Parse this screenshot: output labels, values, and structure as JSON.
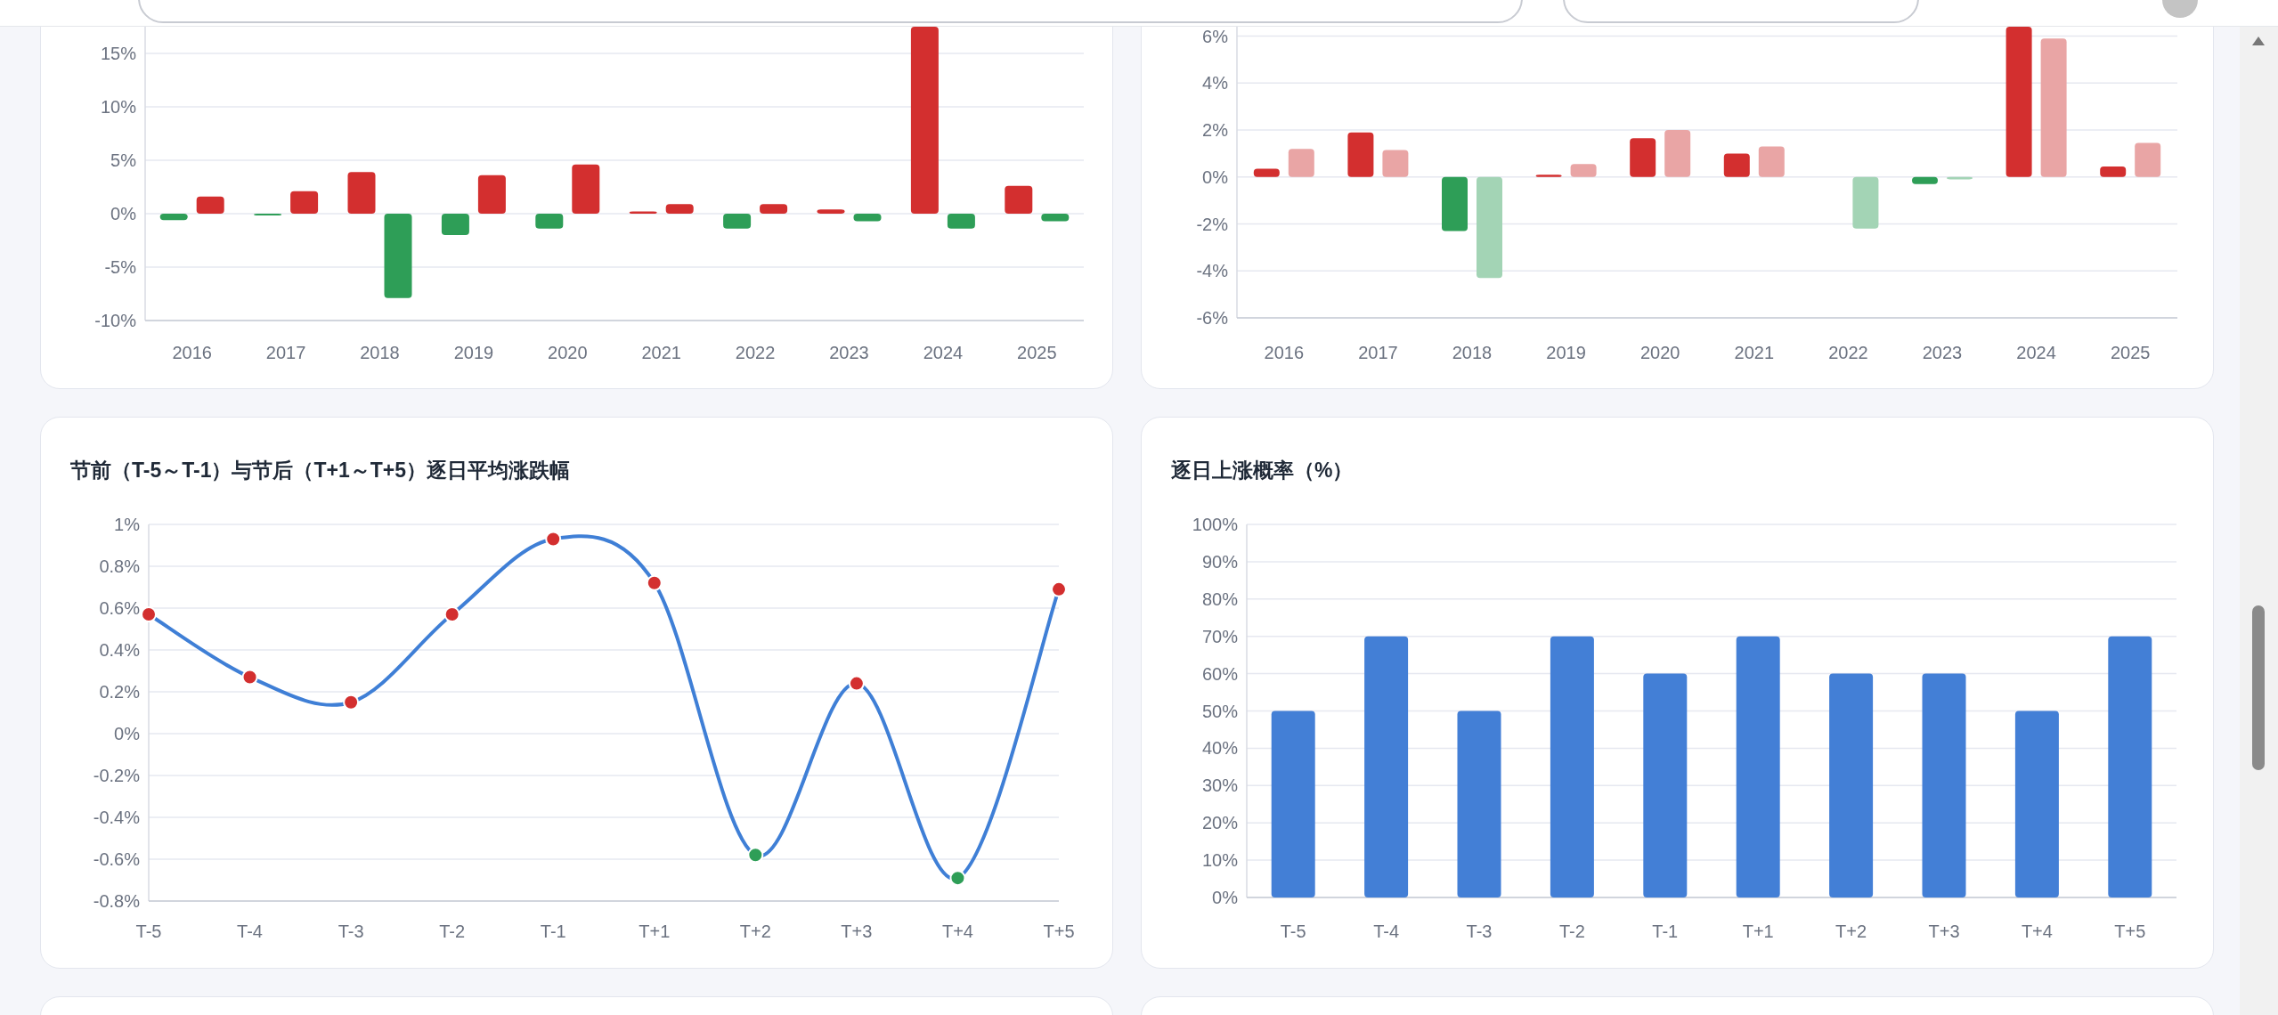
{
  "charts": [
    {
      "chart_data": {
        "type": "bar",
        "grid": true,
        "categories": [
          "2016",
          "2017",
          "2018",
          "2019",
          "2020",
          "2021",
          "2022",
          "2023",
          "2024",
          "2025"
        ],
        "series": [
          {
            "color": "#d32f2f",
            "values": [
              null,
              null,
              3.9,
              null,
              null,
              0.2,
              null,
              0.4,
              17.5,
              2.6
            ]
          },
          {
            "color": "#2e9e57",
            "values": [
              -0.6,
              -0.1,
              null,
              -2.0,
              -1.4,
              null,
              -1.4,
              null,
              null,
              null
            ]
          },
          {
            "color": "#d32f2f",
            "values": [
              1.6,
              2.1,
              null,
              3.6,
              4.6,
              0.9,
              0.9,
              null,
              null,
              null
            ]
          },
          {
            "color": "#2e9e57",
            "values": [
              null,
              null,
              -7.9,
              null,
              null,
              null,
              null,
              -0.7,
              -1.4,
              -0.7
            ]
          }
        ],
        "ylim": [
          -10,
          17.5
        ],
        "yticks": [
          {
            "value": -10,
            "label": "-10%"
          },
          {
            "value": -5,
            "label": "-5%"
          },
          {
            "value": 0,
            "label": "0%"
          },
          {
            "value": 5,
            "label": "5%"
          },
          {
            "value": 10,
            "label": "10%"
          },
          {
            "value": 15,
            "label": "15%"
          }
        ]
      }
    },
    {
      "chart_data": {
        "type": "bar",
        "grid": true,
        "categories": [
          "2016",
          "2017",
          "2018",
          "2019",
          "2020",
          "2021",
          "2022",
          "2023",
          "2024",
          "2025"
        ],
        "series": [
          {
            "color": "#d32f2f",
            "values": [
              0.35,
              1.9,
              null,
              0.1,
              1.65,
              1.0,
              null,
              null,
              6.4,
              0.45
            ]
          },
          {
            "color": "#2e9e57",
            "values": [
              null,
              null,
              -2.3,
              null,
              null,
              null,
              null,
              -0.3,
              null,
              null
            ]
          },
          {
            "color": "#e9a5a5",
            "values": [
              1.2,
              1.15,
              null,
              0.55,
              2.0,
              1.3,
              null,
              null,
              5.9,
              1.45
            ]
          },
          {
            "color": "#a3d4b5",
            "values": [
              null,
              null,
              -4.3,
              null,
              null,
              null,
              -2.2,
              -0.1,
              null,
              null
            ]
          }
        ],
        "ylim": [
          -6,
          6.4
        ],
        "yticks": [
          {
            "value": -6,
            "label": "-6%"
          },
          {
            "value": -4,
            "label": "-4%"
          },
          {
            "value": -2,
            "label": "-2%"
          },
          {
            "value": 0,
            "label": "0%"
          },
          {
            "value": 2,
            "label": "2%"
          },
          {
            "value": 4,
            "label": "4%"
          },
          {
            "value": 6,
            "label": "6%"
          }
        ]
      }
    },
    {
      "title": "节前（T-5～T-1）与节后（T+1～T+5）逐日平均涨跌幅",
      "chart_data": {
        "type": "line",
        "grid": true,
        "categories": [
          "T-5",
          "T-4",
          "T-3",
          "T-2",
          "T-1",
          "T+1",
          "T+2",
          "T+3",
          "T+4",
          "T+5"
        ],
        "series": [
          {
            "color": "#3f7fd6",
            "marker": true,
            "values": [
              0.57,
              0.27,
              0.15,
              0.57,
              0.93,
              0.72,
              -0.58,
              0.24,
              -0.69,
              0.69
            ]
          }
        ],
        "ylim": [
          -0.8,
          1
        ],
        "yticks": [
          {
            "value": -0.8,
            "label": "-0.8%"
          },
          {
            "value": -0.6,
            "label": "-0.6%"
          },
          {
            "value": -0.4,
            "label": "-0.4%"
          },
          {
            "value": -0.2,
            "label": "-0.2%"
          },
          {
            "value": 0,
            "label": "0%"
          },
          {
            "value": 0.2,
            "label": "0.2%"
          },
          {
            "value": 0.4,
            "label": "0.4%"
          },
          {
            "value": 0.6,
            "label": "0.6%"
          },
          {
            "value": 0.8,
            "label": "0.8%"
          },
          {
            "value": 1,
            "label": "1%"
          }
        ]
      }
    },
    {
      "title": "逐日上涨概率（%）",
      "chart_data": {
        "type": "bar",
        "grid": true,
        "categories": [
          "T-5",
          "T-4",
          "T-3",
          "T-2",
          "T-1",
          "T+1",
          "T+2",
          "T+3",
          "T+4",
          "T+5"
        ],
        "series": [
          {
            "color": "#437fd6",
            "values": [
              50,
              70,
              50,
              70,
              60,
              70,
              60,
              60,
              50,
              70
            ]
          }
        ],
        "ylim": [
          0,
          100
        ],
        "yticks": [
          {
            "value": 0,
            "label": "0%"
          },
          {
            "value": 10,
            "label": "10%"
          },
          {
            "value": 20,
            "label": "20%"
          },
          {
            "value": 30,
            "label": "30%"
          },
          {
            "value": 40,
            "label": "40%"
          },
          {
            "value": 50,
            "label": "50%"
          },
          {
            "value": 60,
            "label": "60%"
          },
          {
            "value": 70,
            "label": "70%"
          },
          {
            "value": 80,
            "label": "80%"
          },
          {
            "value": 90,
            "label": "90%"
          },
          {
            "value": 100,
            "label": "100%"
          }
        ]
      }
    }
  ]
}
